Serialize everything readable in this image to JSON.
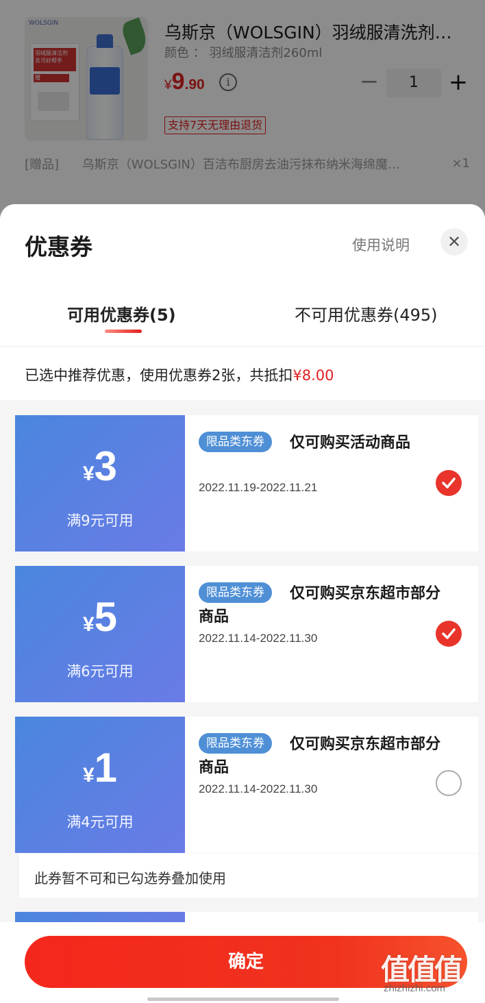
{
  "product": {
    "title": "乌斯京（WOLSGIN）羽绒服清洗剂…",
    "spec_label": "颜色",
    "spec_sep": "：",
    "spec_value": "羽绒服清洁剂260ml",
    "price_symbol": "¥",
    "price_integer": "9",
    "price_decimal": ".90",
    "info_icon": "info-icon",
    "quantity": "1",
    "minus_label": "−",
    "plus_label": "+",
    "return_badge": "支持7天无理由退货",
    "thumb_brand": "WOLSGIN",
    "thumb_promo": "羽绒服清洁剂 去污好帮手",
    "thumb_gift": "赠",
    "gift": {
      "tag": "[赠品]",
      "name": "乌斯京（WOLSGIN）百洁布厨房去油污抹布纳米海绵魔…",
      "qty": "×1"
    }
  },
  "sheet": {
    "title": "优惠券",
    "help_link": "使用说明",
    "close_icon": "close-icon",
    "tabs": [
      {
        "label": "可用优惠券(5)",
        "active": true
      },
      {
        "label": "不可用优惠券(495)",
        "active": false
      }
    ],
    "summary_prefix": "已选中推荐优惠，使用优惠券2张，共抵扣",
    "summary_amount": "¥8.00"
  },
  "coupons": [
    {
      "yen": "¥",
      "amount": "3",
      "condition": "满9元可用",
      "tag": "限品类东券",
      "desc": "仅可购买活动商品",
      "date": "2022.11.19-2022.11.21",
      "selected": true
    },
    {
      "yen": "¥",
      "amount": "5",
      "condition": "满6元可用",
      "tag": "限品类东券",
      "desc": "仅可购买京东超市部分商品",
      "date": "2022.11.14-2022.11.30",
      "selected": true
    },
    {
      "yen": "¥",
      "amount": "1",
      "condition": "满4元可用",
      "tag": "限品类东券",
      "desc": "仅可购买京东超市部分商品",
      "date": "2022.11.14-2022.11.30",
      "selected": false,
      "note": "此券暂不可和已勾选券叠加使用"
    }
  ],
  "footer": {
    "confirm_label": "确定"
  },
  "watermark": {
    "big": "值值值",
    "small": "zhizhizhi.com"
  },
  "colors": {
    "accent_red": "#e02020",
    "coupon_blue": "#4a86de",
    "tag_blue": "#4f8fd6",
    "confirm_red": "#f4271c"
  }
}
